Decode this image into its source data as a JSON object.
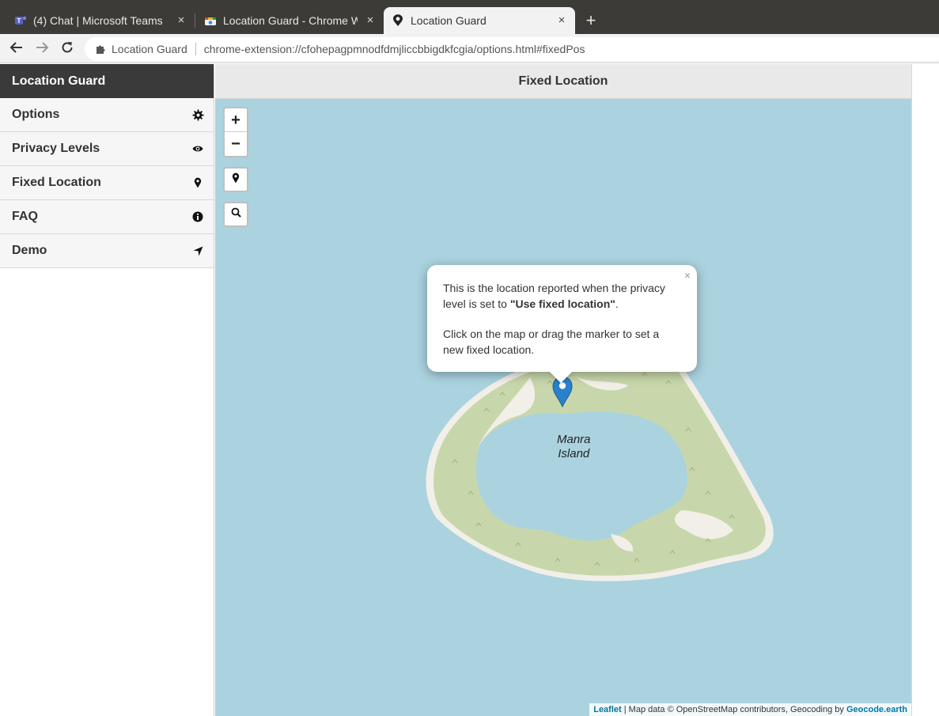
{
  "browser": {
    "tabs": [
      {
        "title": "(4) Chat | Microsoft Teams",
        "icon": "teams-icon",
        "active": false
      },
      {
        "title": "Location Guard - Chrome Web Store",
        "icon": "chrome-web-store-icon",
        "active": false
      },
      {
        "title": "Location Guard",
        "icon": "location-guard-icon",
        "active": true
      }
    ],
    "new_tab_label": "+",
    "close_glyph": "×",
    "omnibox": {
      "origin": "Location Guard",
      "url": "chrome-extension://cfohepagpmnodfdmjliccbbigdkfcgia/options.html#fixedPos"
    }
  },
  "sidebar": {
    "title": "Location Guard",
    "items": [
      {
        "label": "Options",
        "icon": "gear-icon"
      },
      {
        "label": "Privacy Levels",
        "icon": "eye-icon"
      },
      {
        "label": "Fixed Location",
        "icon": "map-pin-icon"
      },
      {
        "label": "FAQ",
        "icon": "info-icon"
      },
      {
        "label": "Demo",
        "icon": "location-arrow-icon"
      }
    ]
  },
  "main": {
    "title": "Fixed Location",
    "map": {
      "zoom_in": "+",
      "zoom_out": "−",
      "island_label_1": "Manra",
      "island_label_2": "Island",
      "popup": {
        "line1_prefix": "This is the location reported when the privacy level is set to ",
        "line1_bold": "\"Use fixed location\"",
        "line1_suffix": ".",
        "line2": "Click on the map or drag the marker to set a new fixed location.",
        "close": "×"
      },
      "attribution": {
        "leaflet": "Leaflet",
        "text": " | Map data © OpenStreetMap contributors, Geocoding by ",
        "geocode": "Geocode.earth"
      }
    }
  },
  "colors": {
    "water": "#aad3df",
    "land": "#c8d7ab",
    "beach": "#f2efe9",
    "marker": "#2a81cb",
    "sidebar_header": "#3a3a3a"
  }
}
